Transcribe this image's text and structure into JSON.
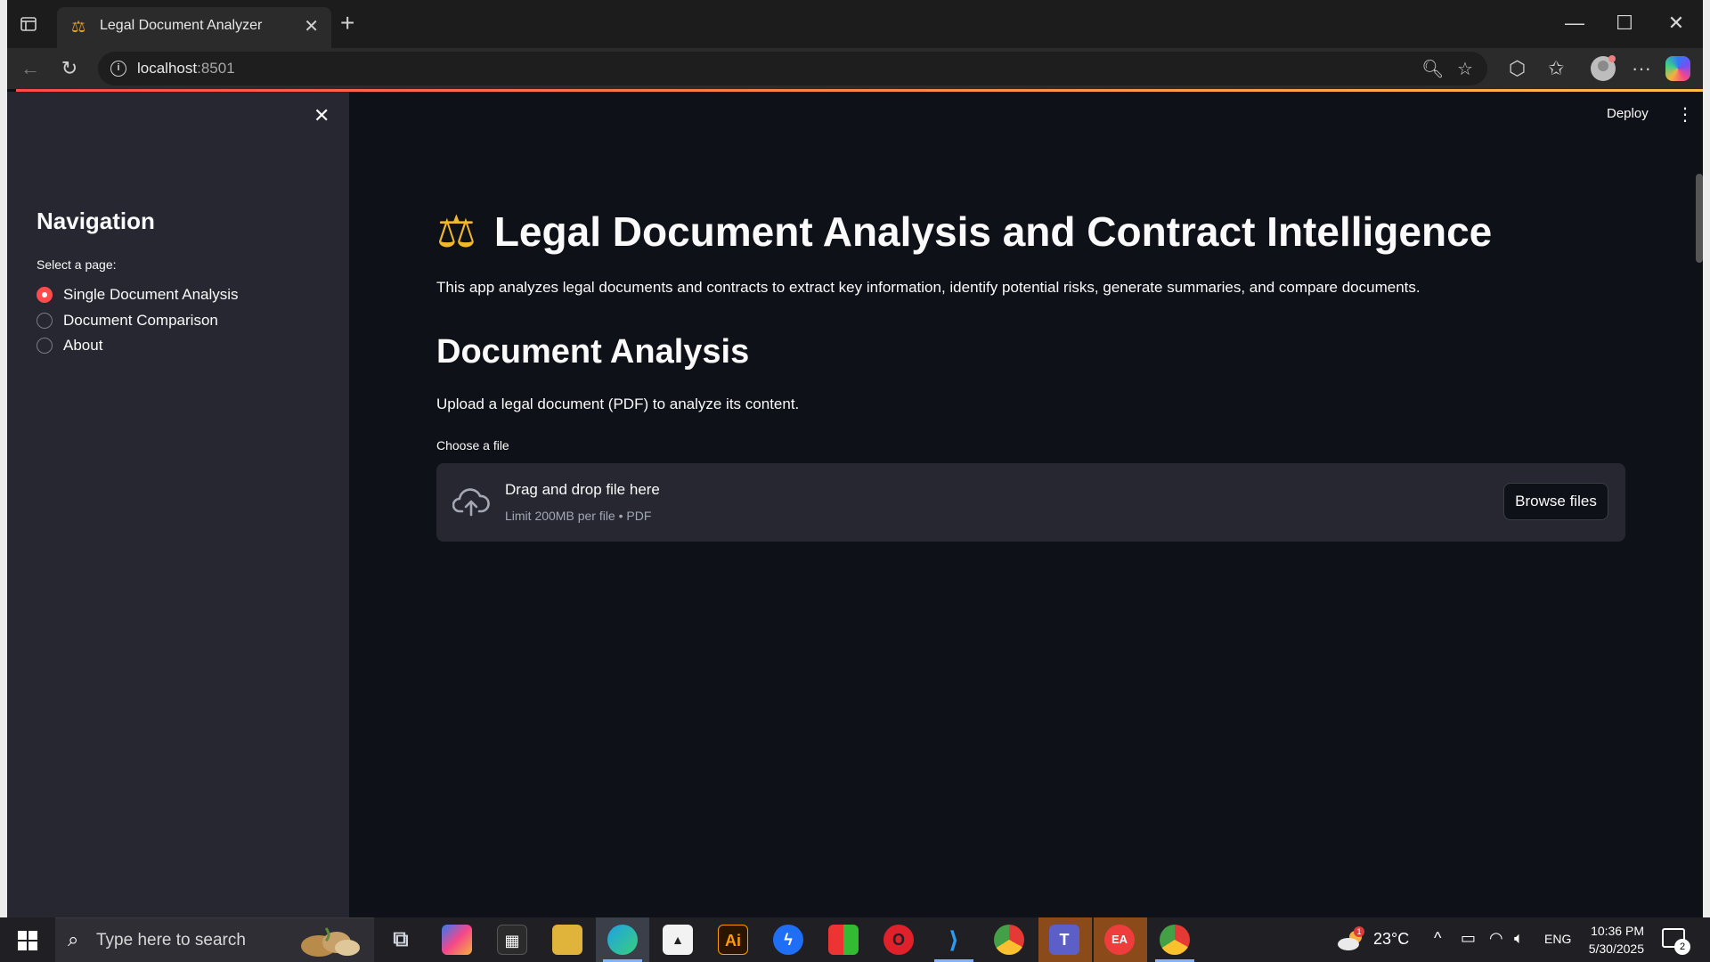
{
  "browser": {
    "tab_title": "Legal Document Analyzer",
    "url_host": "localhost",
    "url_port": ":8501"
  },
  "app": {
    "deploy_label": "Deploy",
    "title": "Legal Document Analysis and Contract Intelligence",
    "intro": "This app analyzes legal documents and contracts to extract key information, identify potential risks, generate summaries, and compare documents.",
    "subheading": "Document Analysis",
    "upload_instructions": "Upload a legal document (PDF) to analyze its content.",
    "file_label": "Choose a file",
    "dropzone": {
      "title": "Drag and drop file here",
      "limit": "Limit 200MB per file • PDF",
      "browse_label": "Browse files"
    }
  },
  "sidebar": {
    "heading": "Navigation",
    "select_label": "Select a page:",
    "options": [
      {
        "label": "Single Document Analysis",
        "selected": true
      },
      {
        "label": "Document Comparison",
        "selected": false
      },
      {
        "label": "About",
        "selected": false
      }
    ]
  },
  "taskbar": {
    "search_placeholder": "Type here to search",
    "temperature": "23°C",
    "language": "ENG",
    "time": "10:36 PM",
    "date": "5/30/2025",
    "notification_count": "2",
    "weather_alert": "1"
  },
  "colors": {
    "accent": "#ff4b4b",
    "main_bg": "#0e1117",
    "sidebar_bg": "#262730"
  }
}
